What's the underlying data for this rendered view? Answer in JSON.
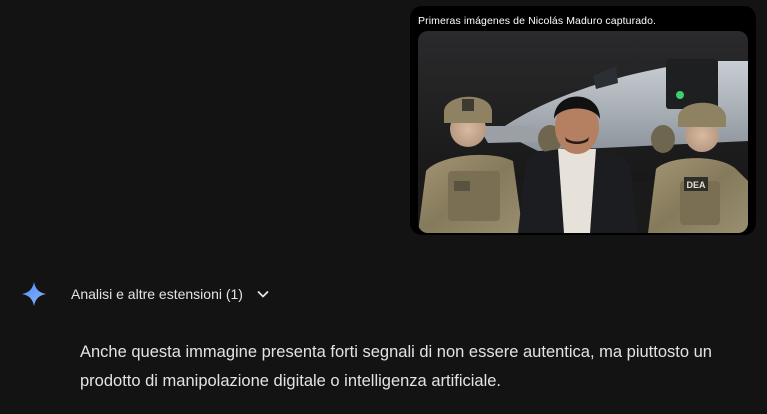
{
  "attachment": {
    "caption": "Primeras imágenes de Nicolás Maduro capturado.",
    "patch_text": "DEA"
  },
  "extensions": {
    "label": "Analisi e altre estensioni (1)",
    "icon": "chevron-down-icon"
  },
  "response": {
    "text": "Anche questa immagine presenta forti segnali di non essere autentica, ma piuttosto un prodotto di manipolazione digitale o intelligenza artificiale."
  },
  "colors": {
    "background": "#131314",
    "text": "#e3e3e3",
    "sparkle_top": "#4f8df9",
    "sparkle_bottom": "#8ab4f8"
  }
}
